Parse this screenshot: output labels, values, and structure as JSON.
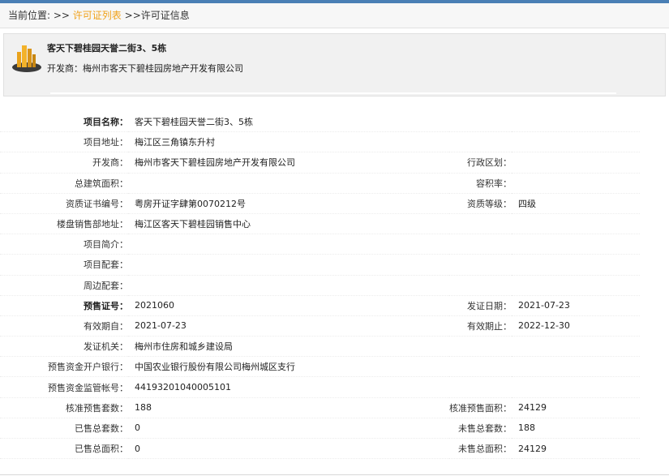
{
  "breadcrumb": {
    "prefix": "当前位置: >>",
    "list_link": "许可证列表",
    "current": ">>许可证信息"
  },
  "header": {
    "icon": "building-icon",
    "title": "客天下碧桂园天誉二街3、5栋",
    "developer_label": "开发商：",
    "developer_value": "梅州市客天下碧桂园房地产开发有限公司"
  },
  "rows": [
    {
      "l1": "项目名称：",
      "v1": "客天下碧桂园天誉二街3、5栋",
      "l2": "",
      "v2": "",
      "bold": true
    },
    {
      "l1": "项目地址：",
      "v1": "梅江区三角镇东升村",
      "l2": "",
      "v2": "",
      "bold": false
    },
    {
      "l1": "开发商：",
      "v1": "梅州市客天下碧桂园房地产开发有限公司",
      "l2": "行政区划：",
      "v2": "",
      "bold": false
    },
    {
      "l1": "总建筑面积：",
      "v1": "",
      "l2": "容积率：",
      "v2": "",
      "bold": false
    },
    {
      "l1": "资质证书编号：",
      "v1": "粤房开证字肆第0070212号",
      "l2": "资质等级：",
      "v2": "四级",
      "bold": false
    },
    {
      "l1": "楼盘销售部地址：",
      "v1": "梅江区客天下碧桂园销售中心",
      "l2": "",
      "v2": "",
      "bold": false
    },
    {
      "l1": "项目简介：",
      "v1": "",
      "l2": "",
      "v2": "",
      "bold": false
    },
    {
      "l1": "项目配套：",
      "v1": "",
      "l2": "",
      "v2": "",
      "bold": false
    },
    {
      "l1": "周边配套：",
      "v1": "",
      "l2": "",
      "v2": "",
      "bold": false
    },
    {
      "l1": "预售证号：",
      "v1": "2021060",
      "l2": "发证日期：",
      "v2": "2021-07-23",
      "bold": true
    },
    {
      "l1": "有效期自：",
      "v1": "2021-07-23",
      "l2": "有效期止：",
      "v2": "2022-12-30",
      "bold": false
    },
    {
      "l1": "发证机关：",
      "v1": "梅州市住房和城乡建设局",
      "l2": "",
      "v2": "",
      "bold": false
    },
    {
      "l1": "预售资金开户银行：",
      "v1": "中国农业银行股份有限公司梅州城区支行",
      "l2": "",
      "v2": "",
      "bold": false
    },
    {
      "l1": "预售资金监管帐号：",
      "v1": "44193201040005101",
      "l2": "",
      "v2": "",
      "bold": false
    },
    {
      "l1": "核准预售套数：",
      "v1": "188",
      "l2": "核准预售面积：",
      "v2": "24129",
      "bold": false
    },
    {
      "l1": "已售总套数：",
      "v1": "0",
      "l2": "未售总套数：",
      "v2": "188",
      "bold": false
    },
    {
      "l1": "已售总面积：",
      "v1": "0",
      "l2": "未售总面积：",
      "v2": "24129",
      "bold": false
    }
  ]
}
